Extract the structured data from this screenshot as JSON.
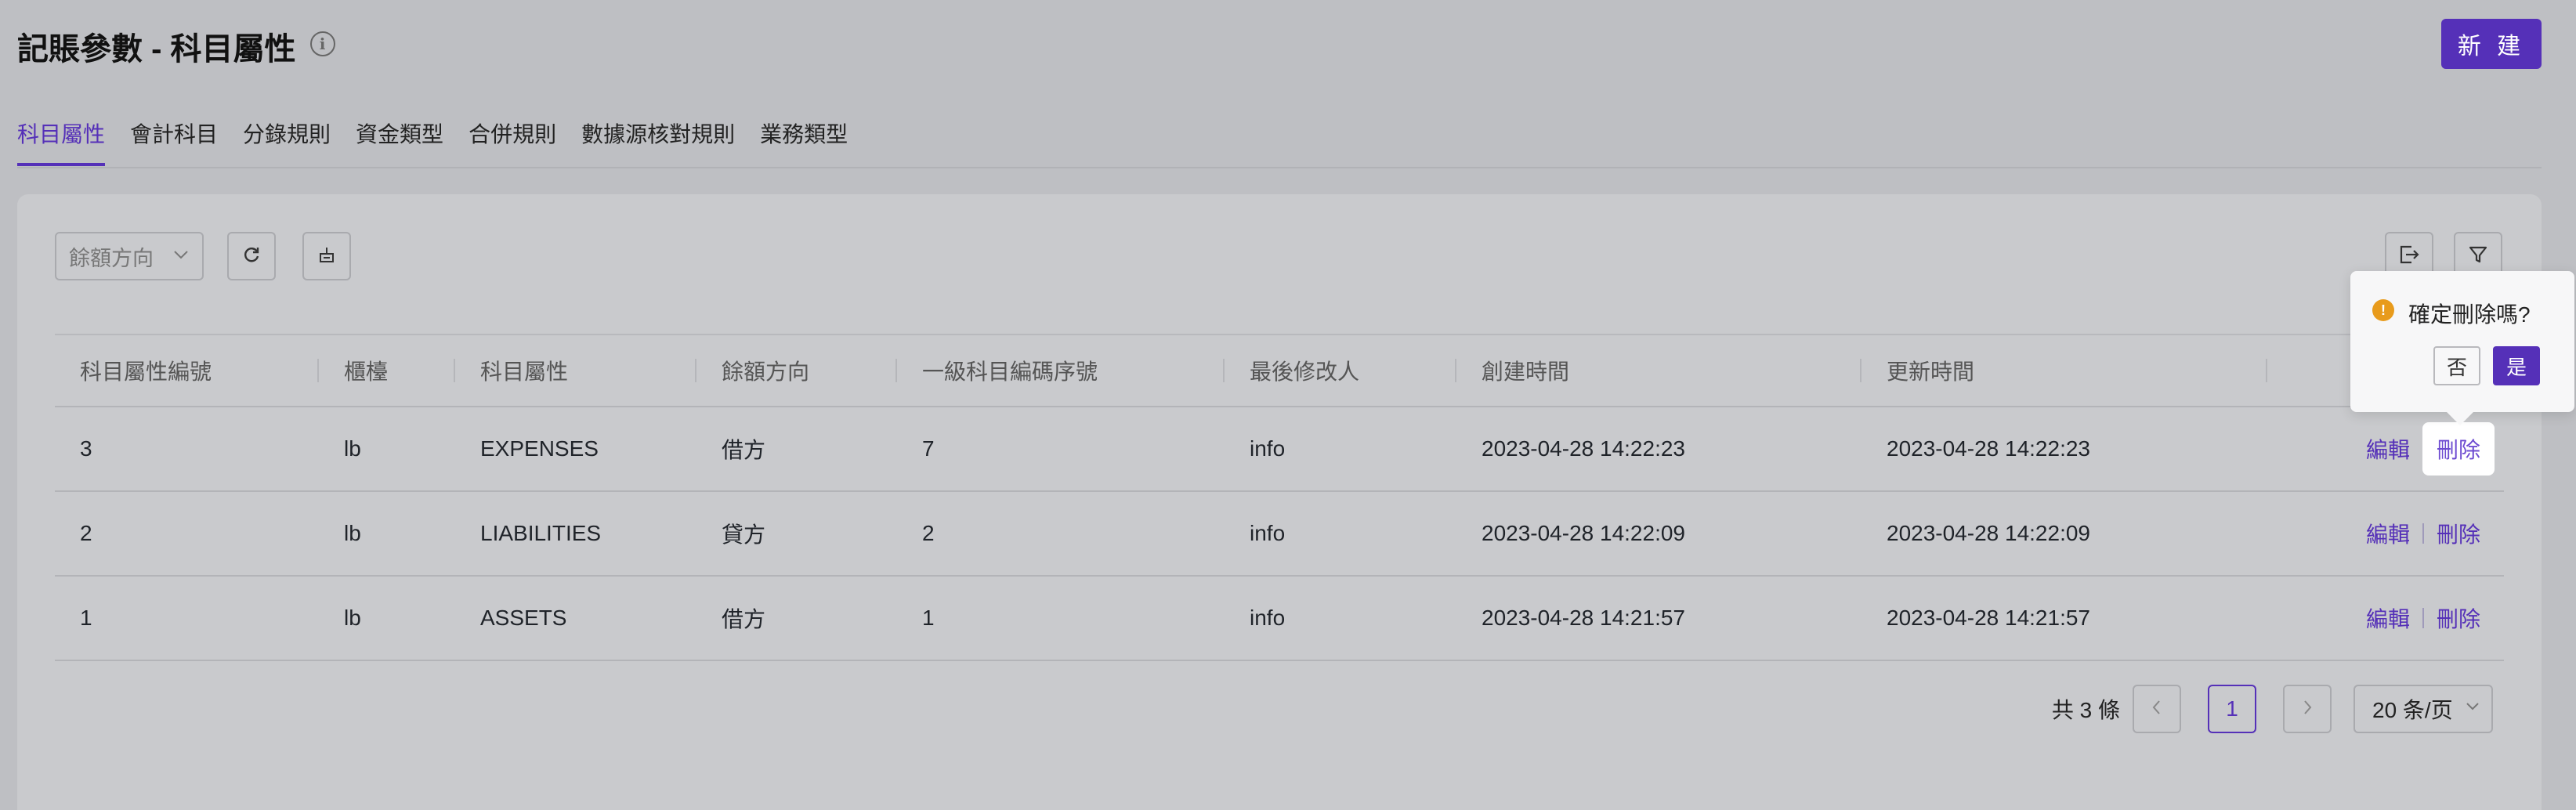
{
  "header": {
    "title": "記賬參數 - 科目屬性",
    "info_icon": "info-icon",
    "new_label": "新 建"
  },
  "tabs": [
    {
      "label": "科目屬性",
      "active": true
    },
    {
      "label": "會計科目"
    },
    {
      "label": "分錄規則"
    },
    {
      "label": "資金類型"
    },
    {
      "label": "合併規則"
    },
    {
      "label": "數據源核對規則"
    },
    {
      "label": "業務類型"
    }
  ],
  "toolbar": {
    "balance_direction_placeholder": "餘額方向",
    "refresh_icon": "refresh-icon",
    "clear_icon": "clear-icon",
    "export_icon": "export-icon",
    "filter_icon": "filter-icon"
  },
  "table": {
    "headers": [
      "科目屬性編號",
      "櫃檯",
      "科目屬性",
      "餘額方向",
      "一級科目編碼序號",
      "最後修改人",
      "創建時間",
      "更新時間"
    ],
    "rows": [
      {
        "id": "3",
        "counter": "lb",
        "attr": "EXPENSES",
        "direction": "借方",
        "seq": "7",
        "modifier": "info",
        "created": "2023-04-28 14:22:23",
        "updated": "2023-04-28 14:22:23",
        "edit": "編輯",
        "delete": "刪除"
      },
      {
        "id": "2",
        "counter": "lb",
        "attr": "LIABILITIES",
        "direction": "貸方",
        "seq": "2",
        "modifier": "info",
        "created": "2023-04-28 14:22:09",
        "updated": "2023-04-28 14:22:09",
        "edit": "編輯",
        "delete": "刪除"
      },
      {
        "id": "1",
        "counter": "lb",
        "attr": "ASSETS",
        "direction": "借方",
        "seq": "1",
        "modifier": "info",
        "created": "2023-04-28 14:21:57",
        "updated": "2023-04-28 14:21:57",
        "edit": "編輯",
        "delete": "刪除"
      }
    ]
  },
  "pagination": {
    "total": "共 3 條",
    "prev": "<",
    "current": "1",
    "next": ">",
    "page_size": "20 条/页"
  },
  "popconfirm": {
    "message": "確定刪除嗎?",
    "no": "否",
    "yes": "是"
  },
  "colors": {
    "accent": "#5530b8",
    "warning": "#e89b1c"
  }
}
